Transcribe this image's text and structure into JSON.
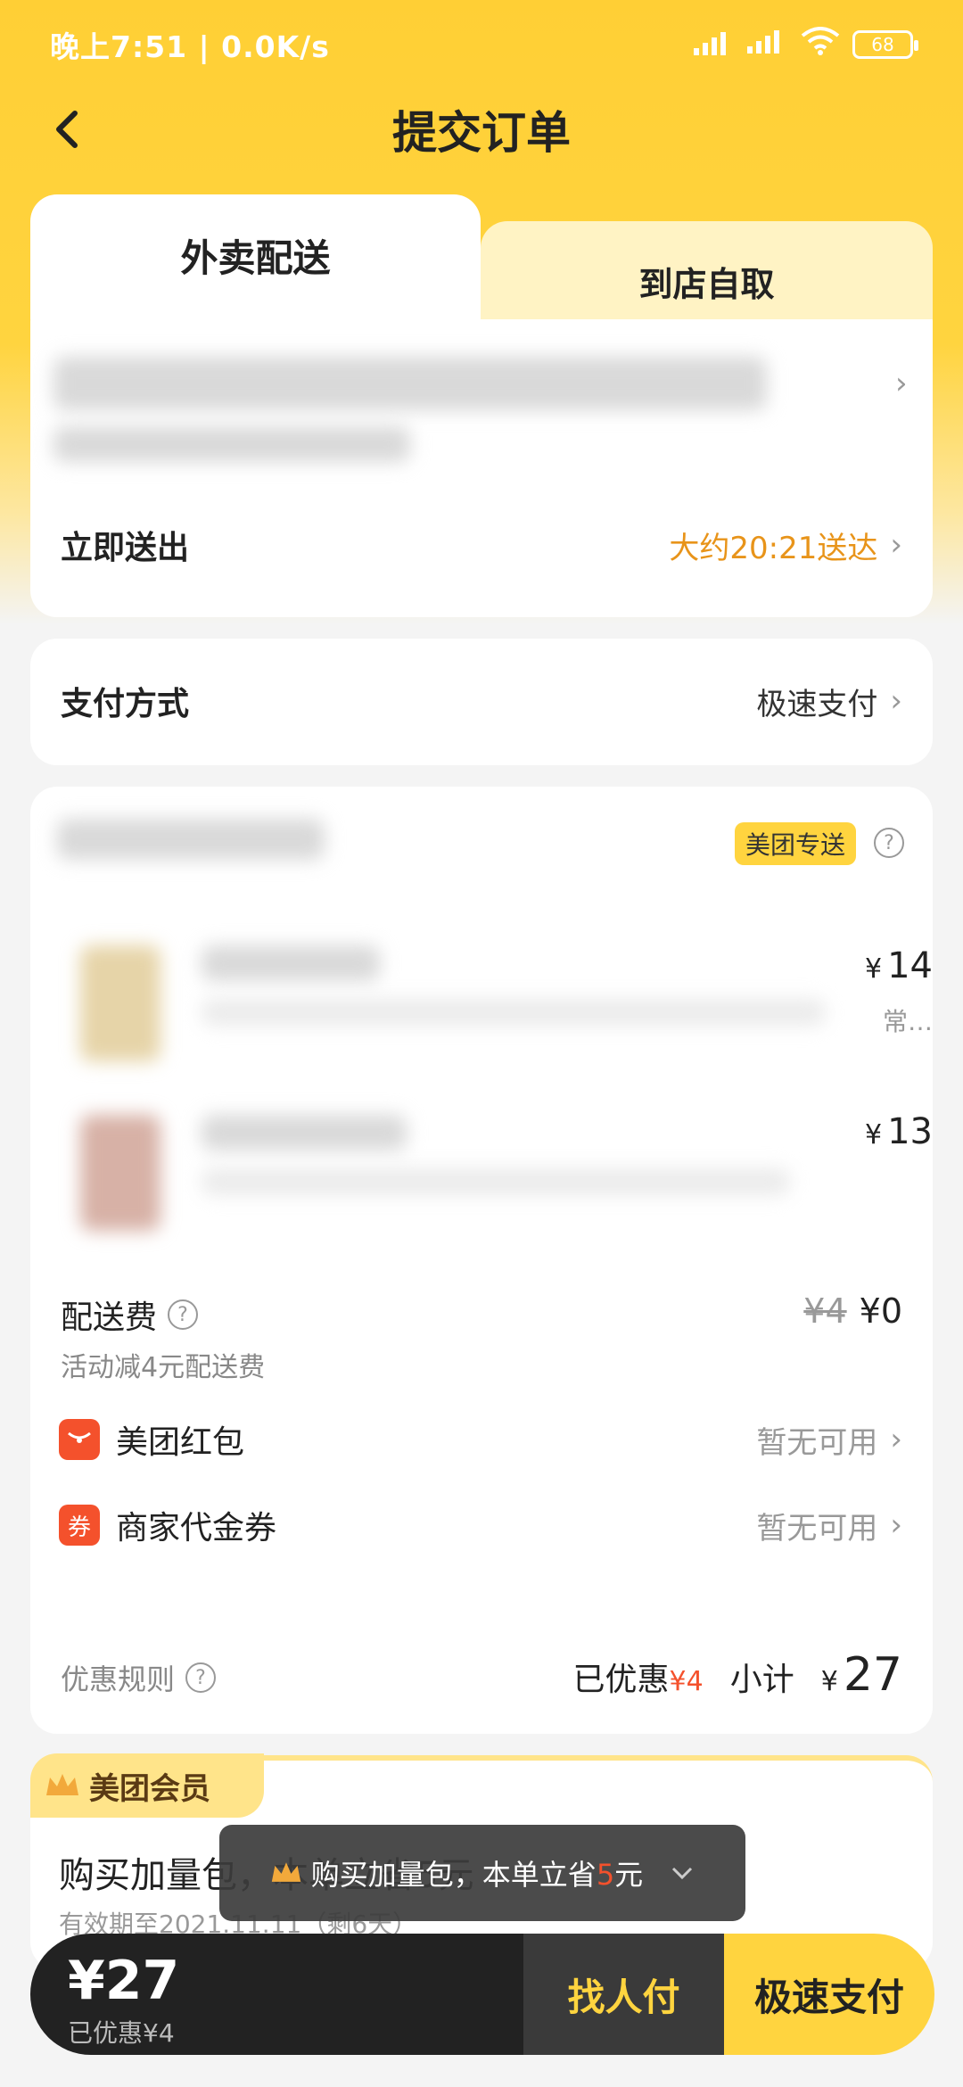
{
  "status": {
    "time_speed": "晚上7:51 | 0.0K/s",
    "battery": "68"
  },
  "nav": {
    "title": "提交订单"
  },
  "tabs": {
    "delivery": "外卖配送",
    "pickup": "到店自取"
  },
  "delivery": {
    "label": "立即送出",
    "eta": "大约20:21送达"
  },
  "payment": {
    "label": "支付方式",
    "value": "极速支付"
  },
  "shop": {
    "badge": "美团专送",
    "items": [
      {
        "price_symbol": "¥",
        "price": "14",
        "note": "常…"
      },
      {
        "price_symbol": "¥",
        "price": "13"
      }
    ]
  },
  "fees": {
    "delivery_label": "配送费",
    "delivery_sub": "活动减4元配送费",
    "delivery_original": "¥4",
    "delivery_final": "¥0",
    "redpacket_label": "美团红包",
    "redpacket_value": "暂无可用",
    "coupon_label": "商家代金券",
    "coupon_icon": "券",
    "coupon_value": "暂无可用",
    "rules_label": "优惠规则",
    "saved_label": "已优惠",
    "saved_value": "¥4",
    "subtotal_label": "小计",
    "subtotal_symbol": "¥",
    "subtotal_value": "27"
  },
  "member": {
    "title": "美团会员",
    "headline": "购买加量包，本单立省5元",
    "validity": "有效期至2021.11.11（剩6天）"
  },
  "toast": {
    "text_pre": "购买加量包，本单立省",
    "highlight": "5",
    "text_post": "元"
  },
  "bottom": {
    "total": "¥27",
    "saved": "已优惠¥4",
    "ask_pay": "找人付",
    "pay": "极速支付"
  },
  "colors": {
    "accent": "#ffd43f",
    "orange": "#e8941a",
    "red": "#f4512c"
  }
}
